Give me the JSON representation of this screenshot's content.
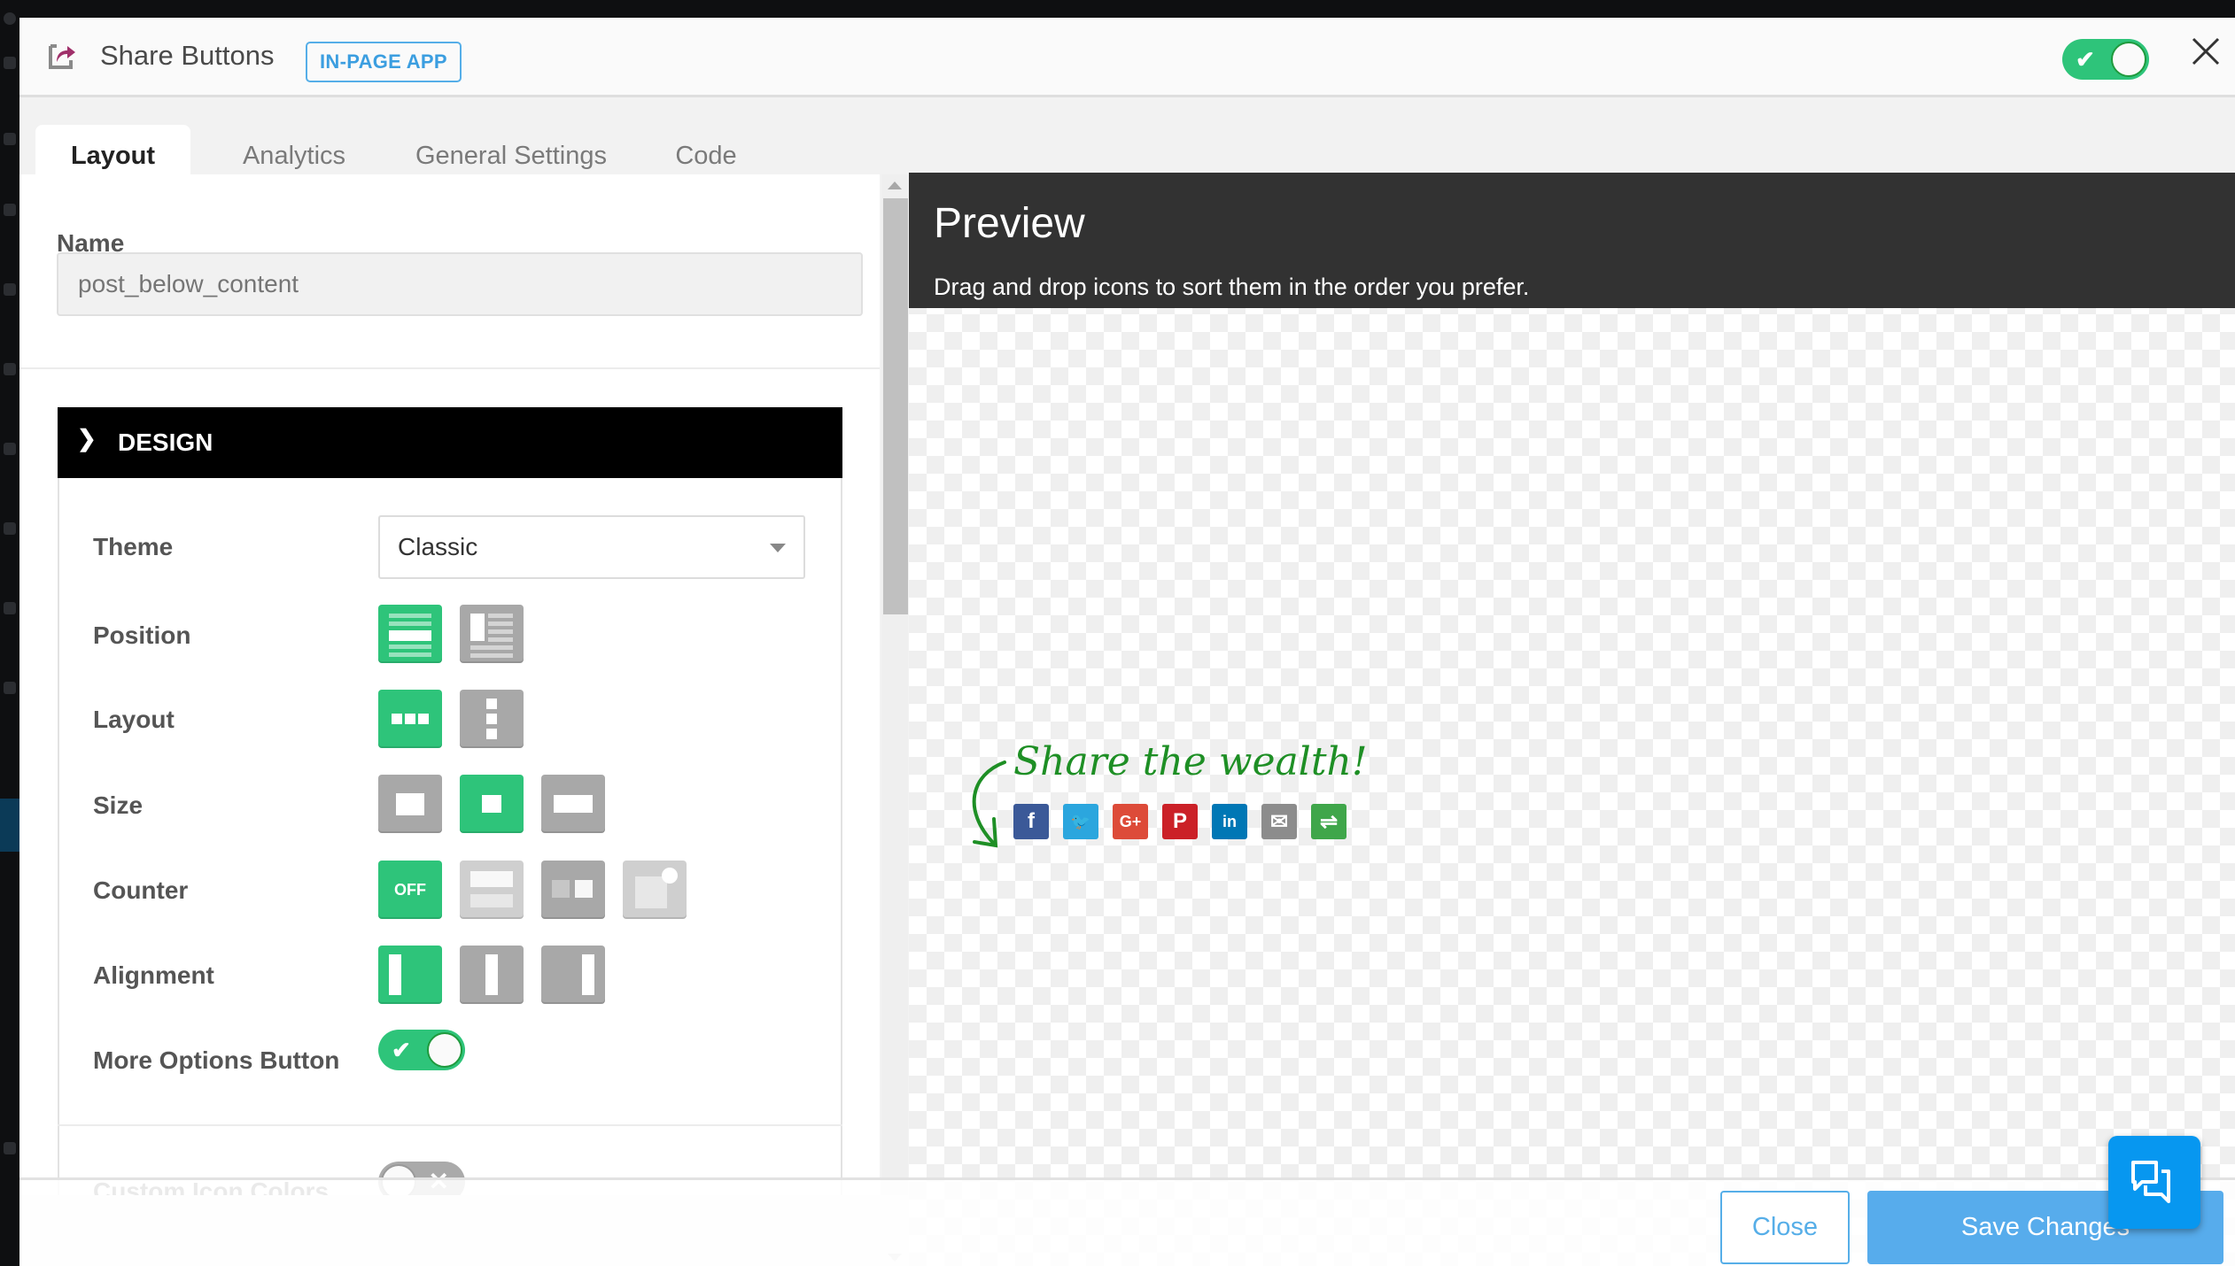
{
  "header": {
    "title": "Share Buttons",
    "badge": "IN-PAGE APP",
    "app_enabled": true,
    "icons": {
      "app": "share-arrow-icon",
      "close": "close-icon"
    }
  },
  "tabs": [
    {
      "label": "Layout",
      "active": true
    },
    {
      "label": "Analytics",
      "active": false
    },
    {
      "label": "General Settings",
      "active": false
    },
    {
      "label": "Code",
      "active": false
    }
  ],
  "form": {
    "name_label": "Name",
    "name_placeholder": "post_below_content",
    "name_value": "",
    "design": {
      "section_label": "DESIGN",
      "expanded": true,
      "theme_label": "Theme",
      "theme_value": "Classic",
      "position_label": "Position",
      "position_options": [
        "below-content",
        "floating-sidebar"
      ],
      "position_selected": 0,
      "layout_label": "Layout",
      "layout_options": [
        "horizontal",
        "vertical"
      ],
      "layout_selected": 0,
      "size_label": "Size",
      "size_options": [
        "large",
        "medium",
        "wide"
      ],
      "size_selected": 1,
      "counter_label": "Counter",
      "counter_off_text": "OFF",
      "counter_options": [
        "off",
        "bubble-top",
        "bubble-side",
        "badge-corner"
      ],
      "counter_selected": 0,
      "alignment_label": "Alignment",
      "alignment_options": [
        "left",
        "center",
        "right"
      ],
      "alignment_selected": 0,
      "more_options_label": "More Options Button",
      "more_options_enabled": true,
      "custom_colors_label": "Custom Icon Colors",
      "custom_colors_enabled": false
    }
  },
  "preview": {
    "title": "Preview",
    "subtitle": "Drag and drop icons to sort them in the order you prefer.",
    "call_to_action": "Share the wealth!",
    "networks": [
      {
        "name": "Facebook",
        "glyph": "f",
        "color": "#3b5998"
      },
      {
        "name": "Twitter",
        "glyph": "🐦",
        "color": "#2ba6de"
      },
      {
        "name": "Google+",
        "glyph": "G+",
        "color": "#dd4b39"
      },
      {
        "name": "Pinterest",
        "glyph": "P",
        "color": "#cb2027"
      },
      {
        "name": "LinkedIn",
        "glyph": "in",
        "color": "#0077b5"
      },
      {
        "name": "Email",
        "glyph": "✉",
        "color": "#8c8c8c"
      },
      {
        "name": "More",
        "glyph": "⇌",
        "color": "#3fa64a"
      }
    ]
  },
  "footer": {
    "close_label": "Close",
    "save_label": "Save Changes"
  },
  "colors": {
    "accent_green": "#2ec47a",
    "accent_blue": "#57acec",
    "chat_blue": "#0797f0"
  }
}
